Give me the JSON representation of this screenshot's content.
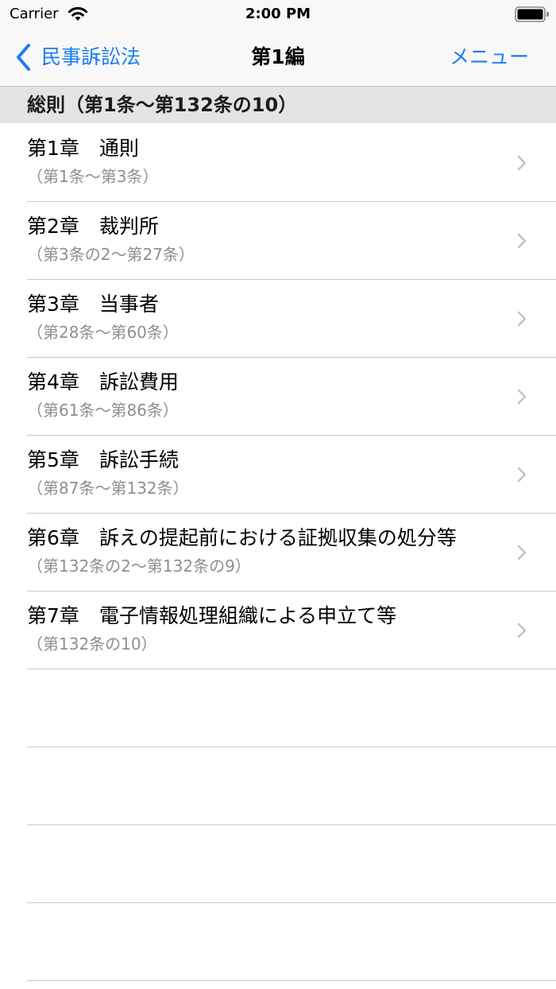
{
  "status_bar": {
    "carrier": "Carrier",
    "time": "2:00 PM"
  },
  "nav": {
    "back_label": "民事訴訟法",
    "title": "第1編",
    "menu_label": "メニュー"
  },
  "section": {
    "header": "総則（第1条〜第132条の10）"
  },
  "chapters": [
    {
      "title": "第1章　通則",
      "subtitle": "（第1条〜第3条）"
    },
    {
      "title": "第2章　裁判所",
      "subtitle": "（第3条の2〜第27条）"
    },
    {
      "title": "第3章　当事者",
      "subtitle": "（第28条〜第60条）"
    },
    {
      "title": "第4章　訴訟費用",
      "subtitle": "（第61条〜第86条）"
    },
    {
      "title": "第5章　訴訟手続",
      "subtitle": "（第87条〜第132条）"
    },
    {
      "title": "第6章　訴えの提起前における証拠収集の処分等",
      "subtitle": "（第132条の2〜第132条の9）"
    },
    {
      "title": "第7章　電子情報処理組織による申立て等",
      "subtitle": "（第132条の10）"
    }
  ],
  "colors": {
    "accent": "#1a7cf5",
    "secondary_text": "#8e8e93",
    "section_background": "#e4e4e6",
    "separator": "#c8c8cc"
  },
  "icons": {
    "wifi": "wifi-icon",
    "battery": "battery-icon",
    "back": "chevron-left-icon",
    "row_disclosure": "chevron-right-icon"
  }
}
